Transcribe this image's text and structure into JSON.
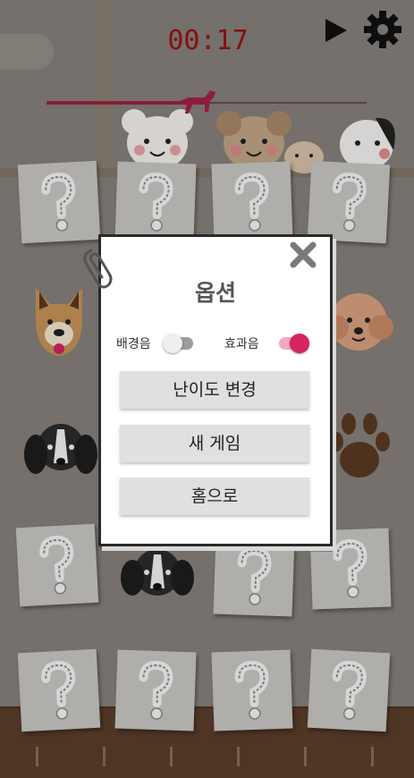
{
  "hud": {
    "timer": "00:17",
    "progress": 0.47,
    "play_icon": "play-icon",
    "settings_icon": "gear-icon"
  },
  "board": {
    "hidden_card_icon": "question-mark-icon",
    "revealed": [
      "jindo-dog",
      "poodle-dog",
      "black-spaniel-dog",
      "paw-print",
      "black-spaniel-dog"
    ]
  },
  "dialog": {
    "title": "옵션",
    "bgm_label": "배경음",
    "bgm_on": false,
    "sfx_label": "효과음",
    "sfx_on": true,
    "buttons": [
      "난이도 변경",
      "새 게임",
      "홈으로"
    ],
    "close_icon": "close-icon"
  },
  "colors": {
    "timer": "#9b1010",
    "toggle_on": "#d6245f",
    "toggle_on_track": "#f2a8c0",
    "toggle_off_knob": "#efefef",
    "toggle_off_track": "#9c9c9c"
  }
}
